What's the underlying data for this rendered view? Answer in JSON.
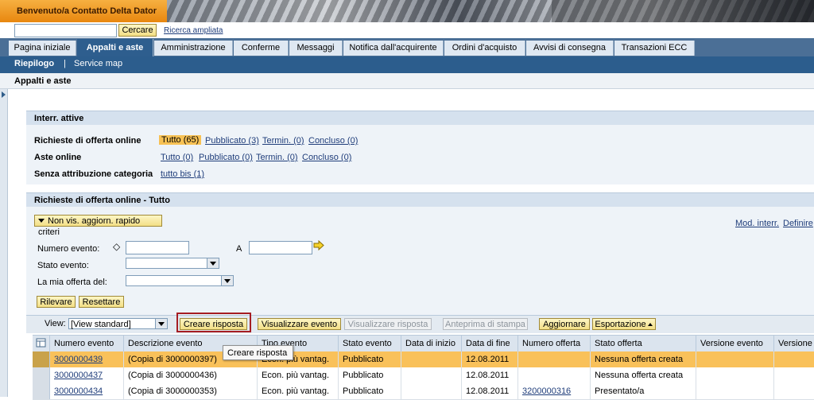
{
  "header": {
    "welcome": "Benvenuto/a Contatto Delta Dator"
  },
  "search": {
    "value": "",
    "button_label": "Cercare",
    "advanced_link": "Ricerca ampliata"
  },
  "tabs": [
    {
      "label": "Pagina iniziale",
      "active": false
    },
    {
      "label": "Appalti e aste",
      "active": true
    },
    {
      "label": "Amministrazione",
      "active": false
    },
    {
      "label": "Conferme",
      "active": false
    },
    {
      "label": "Messaggi",
      "active": false
    },
    {
      "label": "Notifica dall'acquirente",
      "active": false
    },
    {
      "label": "Ordini d'acquisto",
      "active": false
    },
    {
      "label": "Avvisi di consegna",
      "active": false
    },
    {
      "label": "Transazioni ECC",
      "active": false
    }
  ],
  "subnav": {
    "riepilogo": "Riepilogo",
    "separator": "|",
    "service_map": "Service map"
  },
  "page_title": "Appalti e aste",
  "active_queries": {
    "title": "Interr. attive",
    "rows": [
      {
        "label": "Richieste di offerta online",
        "links": [
          "Tutto (65)",
          "Pubblicato (3)",
          "Termin. (0)",
          "Concluso (0)"
        ],
        "selected": 0
      },
      {
        "label": "Aste online",
        "links": [
          "Tutto (0)",
          "Pubblicato (0)",
          "Termin. (0)",
          "Concluso (0)"
        ],
        "selected": -1
      },
      {
        "label": "Senza attribuzione categoria",
        "links": [
          "tutto bis (1)"
        ],
        "selected": -1
      }
    ]
  },
  "results": {
    "title": "Richieste di offerta online - Tutto",
    "toggle_label": "Non vis. aggiorn. rapido criteri",
    "mod_link": "Mod. interr.",
    "def_link": "Definire",
    "filters": {
      "numero_evento": "Numero evento:",
      "a_label": "A",
      "stato_evento": "Stato evento:",
      "mia_offerta": "La mia offerta del:",
      "rilevare": "Rilevare",
      "resettare": "Resettare"
    },
    "toolbar": {
      "view_label": "View:",
      "view_value": "[View standard]",
      "creare_risposta": "Creare risposta",
      "visualizzare_evento": "Visualizzare evento",
      "visualizzare_risposta": "Visualizzare risposta",
      "anteprima": "Anteprima di stampa",
      "aggiornare": "Aggiornare",
      "esportazione": "Esportazione"
    },
    "columns": [
      "Numero evento",
      "Descrizione evento",
      "Tipo evento",
      "Stato evento",
      "Data di inizio",
      "Data di fine",
      "Numero offerta",
      "Stato offerta",
      "Versione evento",
      "Versione"
    ],
    "rows": [
      {
        "numero": "3000000439",
        "descrizione": "(Copia di 3000000397)",
        "tipo": "Econ. più vantag.",
        "stato": "Pubblicato",
        "inizio": "",
        "fine": "12.08.2011",
        "offerta": "",
        "stato_offerta": "Nessuna offerta creata",
        "versione_evento": "",
        "versione": "",
        "selected": true
      },
      {
        "numero": "3000000437",
        "descrizione": "(Copia di 3000000436)",
        "tipo": "Econ. più vantag.",
        "stato": "Pubblicato",
        "inizio": "",
        "fine": "12.08.2011",
        "offerta": "",
        "stato_offerta": "Nessuna offerta creata",
        "versione_evento": "",
        "versione": "",
        "selected": false
      },
      {
        "numero": "3000000434",
        "descrizione": "(Copia di 3000000353)",
        "tipo": "Econ. più vantag.",
        "stato": "Pubblicato",
        "inizio": "",
        "fine": "12.08.2011",
        "offerta": "3200000316",
        "stato_offerta": "Presentato/a",
        "versione_evento": "",
        "versione": "",
        "selected": false
      }
    ]
  },
  "tooltip": "Creare risposta",
  "colors": {
    "header_orange": "#f0a030",
    "tab_active": "#2e5e8e",
    "selection": "#f9c15a",
    "button": "#f5e49a",
    "highlight_border": "#a51d23"
  }
}
